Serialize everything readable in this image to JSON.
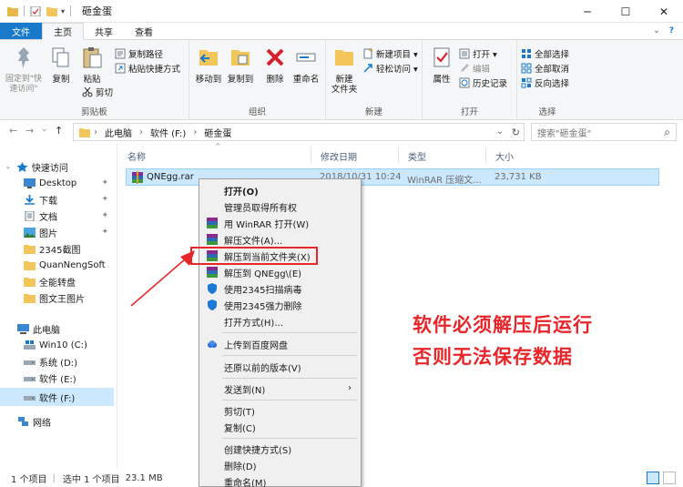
{
  "window": {
    "title": "砸金蛋",
    "minimize": "─",
    "maximize": "☐",
    "close": "✕"
  },
  "tabs": {
    "file": "文件",
    "home": "主页",
    "share": "共享",
    "view": "查看",
    "expand": "⌄",
    "help": "?"
  },
  "ribbon": {
    "clipboard": {
      "label": "剪贴板",
      "pin_quick": "固定到\"快\n速访问\"",
      "copy": "复制",
      "paste": "粘贴",
      "copy_path": "复制路径",
      "paste_shortcut": "粘贴快捷方式",
      "cut": "剪切"
    },
    "organize": {
      "label": "组织",
      "move_to": "移动到",
      "copy_to": "复制到",
      "delete": "删除",
      "rename": "重命名"
    },
    "new": {
      "label": "新建",
      "new_folder": "新建\n文件夹",
      "new_item": "新建项目 ▾",
      "easy_access": "轻松访问 ▾"
    },
    "open": {
      "label": "打开",
      "properties": "属性",
      "open": "打开 ▾",
      "edit": "编辑",
      "history": "历史记录"
    },
    "select": {
      "label": "选择",
      "select_all": "全部选择",
      "select_none": "全部取消",
      "invert": "反向选择"
    }
  },
  "address": {
    "back": "←",
    "forward": "→",
    "recent": "⌄",
    "up": "↑",
    "crumbs": [
      "此电脑",
      "软件 (F:)",
      "砸金蛋"
    ],
    "separator": "›",
    "dropdown": "⌄",
    "refresh": "↻",
    "search_placeholder": "搜索\"砸金蛋\"",
    "search_icon": "⌕"
  },
  "nav": {
    "quick_access": "快速访问",
    "items": [
      {
        "label": "Desktop",
        "pinned": true
      },
      {
        "label": "下载",
        "pinned": true
      },
      {
        "label": "文档",
        "pinned": true
      },
      {
        "label": "图片",
        "pinned": true
      },
      {
        "label": "2345截图",
        "pinned": false
      },
      {
        "label": "QuanNengSoft",
        "pinned": false
      },
      {
        "label": "全能转盘",
        "pinned": false
      },
      {
        "label": "图文王图片",
        "pinned": false
      }
    ],
    "this_pc": "此电脑",
    "drives": [
      "Win10 (C:)",
      "系统 (D:)",
      "软件 (E:)",
      "软件 (F:)"
    ],
    "network": "网络",
    "pin_glyph": "📌"
  },
  "columns": {
    "name": "名称",
    "modified": "修改日期",
    "type": "类型",
    "size": "大小",
    "sort_glyph": "^"
  },
  "file": {
    "name": "QNEgg.rar",
    "modified": "2018/10/31 10:24",
    "type": "WinRAR 压缩文...",
    "size": "23,731 KB"
  },
  "status": {
    "count": "1 个项目",
    "selected": "选中 1 个项目",
    "size": "23.1 MB"
  },
  "context_menu": {
    "items": [
      {
        "label": "打开(O)",
        "bold": true,
        "icon": "none"
      },
      {
        "label": "管理员取得所有权",
        "icon": "none"
      },
      {
        "label": "用 WinRAR 打开(W)",
        "icon": "winrar"
      },
      {
        "label": "解压文件(A)...",
        "icon": "winrar"
      },
      {
        "label": "解压到当前文件夹(X)",
        "icon": "winrar"
      },
      {
        "label": "解压到 QNEgg\\(E)",
        "icon": "winrar"
      },
      {
        "label": "使用2345扫描病毒",
        "icon": "shield"
      },
      {
        "label": "使用2345强力删除",
        "icon": "shield"
      },
      {
        "label": "打开方式(H)...",
        "icon": "none"
      },
      {
        "label": "上传到百度网盘",
        "icon": "baidu"
      },
      {
        "label": "还原以前的版本(V)",
        "icon": "none"
      },
      {
        "label": "发送到(N)",
        "icon": "none"
      },
      {
        "label": "剪切(T)",
        "icon": "none"
      },
      {
        "label": "复制(C)",
        "icon": "none"
      },
      {
        "label": "创建快捷方式(S)",
        "icon": "none"
      },
      {
        "label": "删除(D)",
        "icon": "none"
      },
      {
        "label": "重命名(M)",
        "icon": "none"
      }
    ],
    "submenu_arrow": "›"
  },
  "annotation": {
    "line1": "软件必须解压后运行",
    "line2": "否则无法保存数据",
    "color": "#e8262a"
  }
}
